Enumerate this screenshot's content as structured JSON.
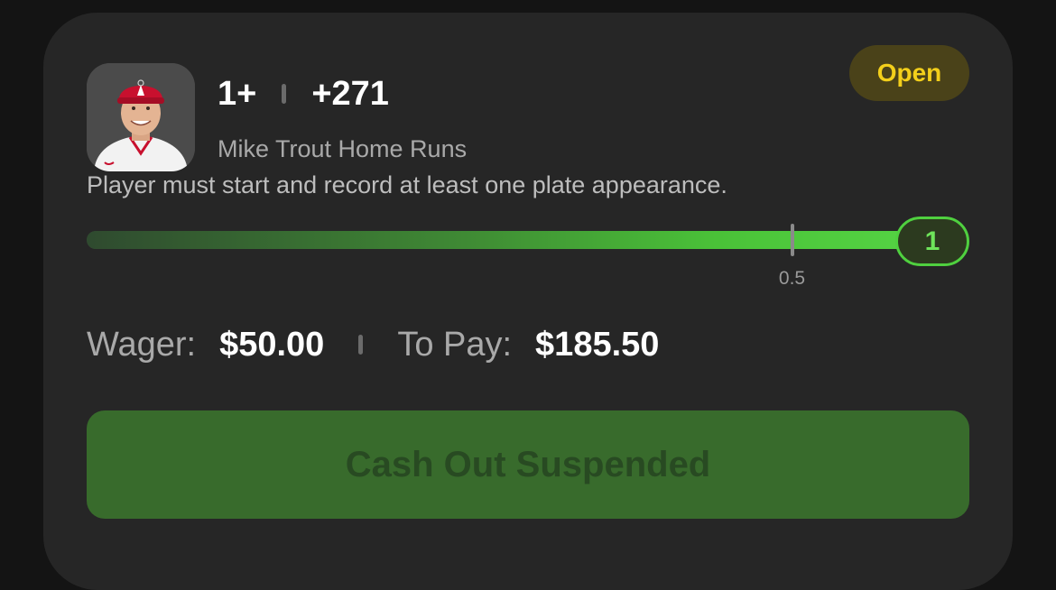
{
  "bet": {
    "line": "1+",
    "odds": "+271",
    "market": "Mike Trout Home Runs",
    "rule": "Player must start and record at least one plate appearance.",
    "status": "Open"
  },
  "progress": {
    "threshold_label": "0.5",
    "threshold": 0.5,
    "current_value": "1",
    "fill_fraction": 1.0
  },
  "wager": {
    "wager_label": "Wager:",
    "wager_value": "$50.00",
    "pay_label": "To Pay:",
    "pay_value": "$185.50"
  },
  "actions": {
    "cashout_label": "Cash Out Suspended"
  },
  "icons": {
    "avatar": "player-headshot"
  },
  "colors": {
    "status_badge_bg": "#4a4219",
    "status_badge_text": "#f3cf1b",
    "progress_green": "#4ac238",
    "cashout_bg": "#386b2c",
    "cashout_text": "#284a22"
  }
}
